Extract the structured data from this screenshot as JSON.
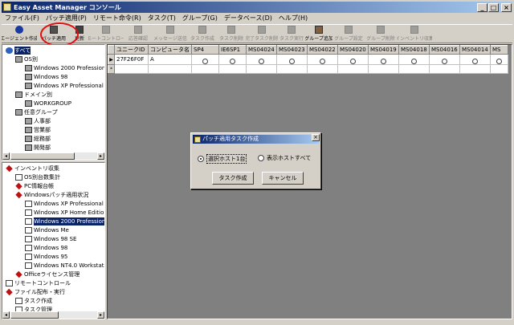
{
  "window": {
    "title": "Easy Asset Manager コンソール",
    "min": "_",
    "max": "□",
    "close": "×"
  },
  "menu": [
    "ファイル(F)",
    "パッチ適用(P)",
    "リモート命令(R)",
    "タスク(T)",
    "グループ(G)",
    "データベース(D)",
    "ヘルプ(H)"
  ],
  "toolbar": [
    {
      "label": "エージェント作成",
      "icon": "agent-info-icon",
      "enabled": true
    },
    {
      "label": "パッチ適用",
      "icon": "patch-apply-icon",
      "enabled": true
    },
    {
      "label": "更新",
      "icon": "refresh-icon",
      "enabled": true
    },
    {
      "label": "リモートコントロール",
      "icon": "remote-control-icon",
      "enabled": false
    },
    {
      "label": "応答確認",
      "icon": "ping-icon",
      "enabled": false
    },
    {
      "label": "メッセージ送信",
      "icon": "message-icon",
      "enabled": false
    },
    {
      "label": "タスク作成",
      "icon": "task-create-icon",
      "enabled": false
    },
    {
      "label": "タスク削除",
      "icon": "task-delete-icon",
      "enabled": false
    },
    {
      "label": "完了タスク削除",
      "icon": "done-task-delete-icon",
      "enabled": false
    },
    {
      "label": "タスク実行",
      "icon": "task-run-icon",
      "enabled": false
    },
    {
      "label": "グループ追加",
      "icon": "group-add-icon",
      "enabled": true
    },
    {
      "label": "グループ設定",
      "icon": "group-settings-icon",
      "enabled": false
    },
    {
      "label": "グループ削除",
      "icon": "group-delete-icon",
      "enabled": false
    },
    {
      "label": "インベントリ収集",
      "icon": "inventory-collect-icon",
      "enabled": false
    }
  ],
  "tree_top": [
    {
      "label": "すべて",
      "level": 0,
      "icon": "globe-icon",
      "selected": true
    },
    {
      "label": "OS別",
      "level": 1,
      "icon": "computers-icon"
    },
    {
      "label": "Windows 2000 Professional",
      "level": 2,
      "icon": "computers-icon"
    },
    {
      "label": "Windows 98",
      "level": 2,
      "icon": "computers-icon"
    },
    {
      "label": "Windows XP Professional",
      "level": 2,
      "icon": "computers-icon"
    },
    {
      "label": "ドメイン別",
      "level": 1,
      "icon": "computers-icon"
    },
    {
      "label": "WORKGROUP",
      "level": 2,
      "icon": "computers-icon"
    },
    {
      "label": "任意グループ",
      "level": 1,
      "icon": "computers-icon"
    },
    {
      "label": "人事部",
      "level": 2,
      "icon": "computers-icon"
    },
    {
      "label": "営業部",
      "level": 2,
      "icon": "computers-icon"
    },
    {
      "label": "総務部",
      "level": 2,
      "icon": "computers-icon"
    },
    {
      "label": "開発部",
      "level": 2,
      "icon": "computers-icon"
    }
  ],
  "tree_bottom": [
    {
      "label": "インベントリ収集",
      "level": 0,
      "icon": "diamond-icon"
    },
    {
      "label": "OS別台数集計",
      "level": 1,
      "icon": "doc-icon"
    },
    {
      "label": "PC情報台帳",
      "level": 1,
      "icon": "diamond-icon"
    },
    {
      "label": "Windowsパッチ適用状況",
      "level": 1,
      "icon": "diamond-icon"
    },
    {
      "label": "Windows XP Professional",
      "level": 2,
      "icon": "doc-icon"
    },
    {
      "label": "Windows XP Home Edition",
      "level": 2,
      "icon": "doc-icon"
    },
    {
      "label": "Windows 2000 Professional",
      "level": 2,
      "icon": "doc-icon",
      "selected": true
    },
    {
      "label": "Windows Me",
      "level": 2,
      "icon": "doc-icon"
    },
    {
      "label": "Windows 98 SE",
      "level": 2,
      "icon": "doc-icon"
    },
    {
      "label": "Windows 98",
      "level": 2,
      "icon": "doc-icon"
    },
    {
      "label": "Windows 95",
      "level": 2,
      "icon": "doc-icon"
    },
    {
      "label": "Windows NT4.0 Workstation",
      "level": 2,
      "icon": "doc-icon"
    },
    {
      "label": "Officeライセンス管理",
      "level": 1,
      "icon": "diamond-icon"
    },
    {
      "label": "リモートコントロール",
      "level": 0,
      "icon": "doc-icon"
    },
    {
      "label": "ファイル配布・実行",
      "level": 0,
      "icon": "diamond-icon"
    },
    {
      "label": "タスク作成",
      "level": 1,
      "icon": "doc-icon"
    },
    {
      "label": "タスク管理",
      "level": 1,
      "icon": "doc-icon"
    }
  ],
  "grid": {
    "columns": [
      "ユニークID",
      "コンピュータ名",
      "SP4",
      "IE6SP1",
      "MS04024",
      "MS04023",
      "MS04022",
      "MS04020",
      "MS04019",
      "MS04018",
      "MS04016",
      "MS04014",
      "MS"
    ],
    "rows": [
      [
        "27F26F0F",
        "A",
        "○",
        "○",
        "○",
        "○",
        "○",
        "○",
        "○",
        "○",
        "○",
        "○",
        "○"
      ]
    ],
    "new_row_marker": "*",
    "current_row_marker": "▶"
  },
  "dialog": {
    "title": "パッチ適用タスク作成",
    "radio1": "選択ホスト1台",
    "radio2": "表示ホストすべて",
    "ok": "タスク作成",
    "cancel": "キャンセル",
    "close": "×"
  },
  "colors": {
    "titlebar": "#0a246a",
    "face": "#d4d0c8",
    "highlight_ring": "#e01010"
  }
}
